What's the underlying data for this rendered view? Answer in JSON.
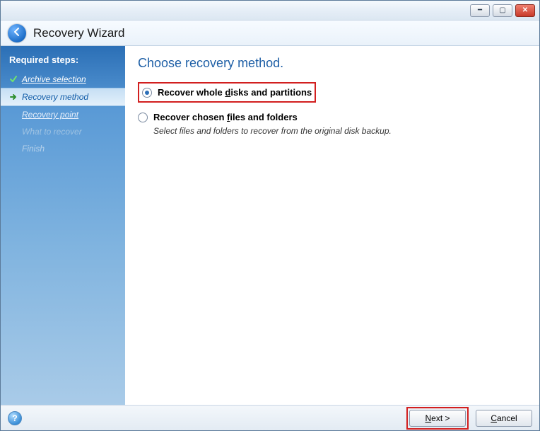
{
  "window": {
    "title": "Recovery Wizard"
  },
  "sidebar": {
    "section_title": "Required steps:",
    "steps": [
      {
        "label": "Archive selection",
        "state": "completed"
      },
      {
        "label": "Recovery method",
        "state": "current"
      },
      {
        "label": "Recovery point",
        "state": "link"
      },
      {
        "label": "What to recover",
        "state": "disabled"
      },
      {
        "label": "Finish",
        "state": "faded"
      }
    ]
  },
  "content": {
    "title": "Choose recovery method.",
    "options": [
      {
        "label_pre": "Recover whole ",
        "label_ul": "d",
        "label_post": "isks and partitions",
        "selected": true,
        "highlighted": true
      },
      {
        "label_pre": "Recover chosen ",
        "label_ul": "f",
        "label_post": "iles and folders",
        "selected": false,
        "desc": "Select files and folders to recover from the original disk backup."
      }
    ]
  },
  "footer": {
    "next_pre": "",
    "next_ul": "N",
    "next_post": "ext >",
    "cancel_ul": "C",
    "cancel_post": "ancel"
  }
}
